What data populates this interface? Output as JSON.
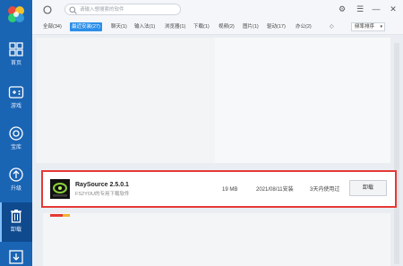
{
  "sidebar": {
    "items": [
      {
        "label": "首页",
        "icon": "home-icon"
      },
      {
        "label": "游戏",
        "icon": "gamepad-icon"
      },
      {
        "label": "宝库",
        "icon": "treasure-icon"
      },
      {
        "label": "升级",
        "icon": "upgrade-icon"
      },
      {
        "label": "卸载",
        "icon": "trash-icon"
      },
      {
        "label": "",
        "icon": "download-icon"
      }
    ]
  },
  "search": {
    "placeholder": "请输入想搜索的软件"
  },
  "window": {
    "settings": "⚙",
    "menu": "☰",
    "minimize": "—",
    "close": "✕"
  },
  "tabs": [
    {
      "label": "全部(34)"
    },
    {
      "label": "最近安装(27)"
    },
    {
      "label": "聊天(1)"
    },
    {
      "label": "输入法(1)"
    },
    {
      "label": "浏览器(1)"
    },
    {
      "label": "下载(1)"
    },
    {
      "label": "视频(2)"
    },
    {
      "label": "图片(1)"
    },
    {
      "label": "驱动(17)"
    },
    {
      "label": "办公(2)"
    }
  ],
  "tabs_more": "◇",
  "sort": {
    "label": "频率排序",
    "caret": "▾"
  },
  "app": {
    "name": "RaySource 2.5.0.1",
    "desc": "FS2YOU的专用下载软件",
    "size": "19 MB",
    "date": "2021/08/11安装",
    "used": "3天内使用过",
    "button": "卸载"
  },
  "colors": {
    "sidebar": "#1a64b4",
    "accent": "#2b8ee8",
    "highlight": "#e53935"
  }
}
